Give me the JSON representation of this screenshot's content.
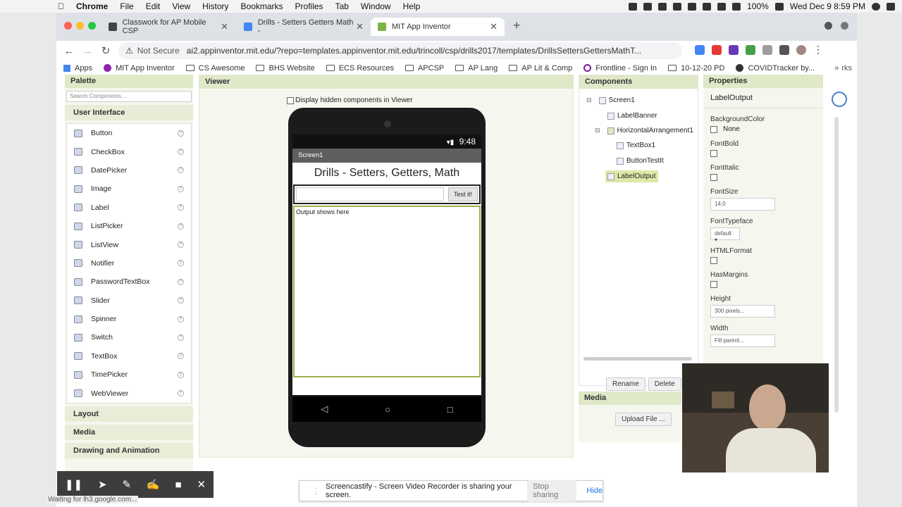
{
  "mac_menu": {
    "app": "Chrome",
    "items": [
      "File",
      "Edit",
      "View",
      "History",
      "Bookmarks",
      "Profiles",
      "Tab",
      "Window",
      "Help"
    ],
    "battery": "100%",
    "datetime": "Wed Dec 9  8:59 PM"
  },
  "browser": {
    "tabs": [
      {
        "title": "Classwork for AP Mobile CSP",
        "icon_color": "#333333"
      },
      {
        "title": "Drills - Setters Getters Math -",
        "icon_color": "#4285f4"
      },
      {
        "title": "MIT App Inventor",
        "icon_color": "#7cb342"
      }
    ],
    "security": "Not Secure",
    "url": "ai2.appinventor.mit.edu/?repo=templates.appinventor.mit.edu/trincoll/csp/drills2017/templates/DrillsSettersGettersMathT...",
    "bookmarks": [
      "Apps",
      "MIT App Inventor",
      "CS Awesome",
      "BHS Website",
      "ECS Resources",
      "APCSP",
      "AP Lang",
      "AP Lit & Comp",
      "Frontline - Sign In",
      "10-12-20 PD",
      "COVIDTracker by..."
    ],
    "bookmarks_overflow": "rks"
  },
  "palette": {
    "title": "Palette",
    "search_placeholder": "Search Components...",
    "category": "User Interface",
    "items": [
      "Button",
      "CheckBox",
      "DatePicker",
      "Image",
      "Label",
      "ListPicker",
      "ListView",
      "Notifier",
      "PasswordTextBox",
      "Slider",
      "Spinner",
      "Switch",
      "TextBox",
      "TimePicker",
      "WebViewer"
    ],
    "help_glyph": "?",
    "other_categories": [
      "Layout",
      "Media",
      "Drawing and Animation"
    ]
  },
  "viewer": {
    "title": "Viewer",
    "hidden_label": "Display hidden components in Viewer",
    "phone_time": "9:48",
    "screen_name": "Screen1",
    "banner": "Drills - Setters, Getters, Math",
    "button_label": "Test it!",
    "output_text": "Output shows here"
  },
  "components": {
    "title": "Components",
    "tree": [
      "Screen1",
      "LabelBanner",
      "HorizontalArrangement1",
      "TextBox1",
      "ButtonTestIt",
      "LabelOutput"
    ],
    "rename": "Rename",
    "delete": "Delete"
  },
  "media": {
    "title": "Media",
    "upload": "Upload File ..."
  },
  "properties": {
    "title": "Properties",
    "component": "LabelOutput",
    "bgcolor_label": "BackgroundColor",
    "bgcolor_value": "None",
    "fontbold": "FontBold",
    "fontitalic": "FontItalic",
    "fontsize_label": "FontSize",
    "fontsize_value": "14.0",
    "typeface_label": "FontTypeface",
    "typeface_value": "default ▾",
    "htmlformat": "HTMLFormat",
    "hasmargins": "HasMargins",
    "height_label": "Height",
    "height_value": "300 pixels...",
    "width_label": "Width",
    "width_value": "Fill parent..."
  },
  "sharing": {
    "message": "Screencastify - Screen Video Recorder is sharing your screen.",
    "stop": "Stop sharing",
    "hide": "Hide"
  },
  "status": "Waiting for lh3.google.com..."
}
